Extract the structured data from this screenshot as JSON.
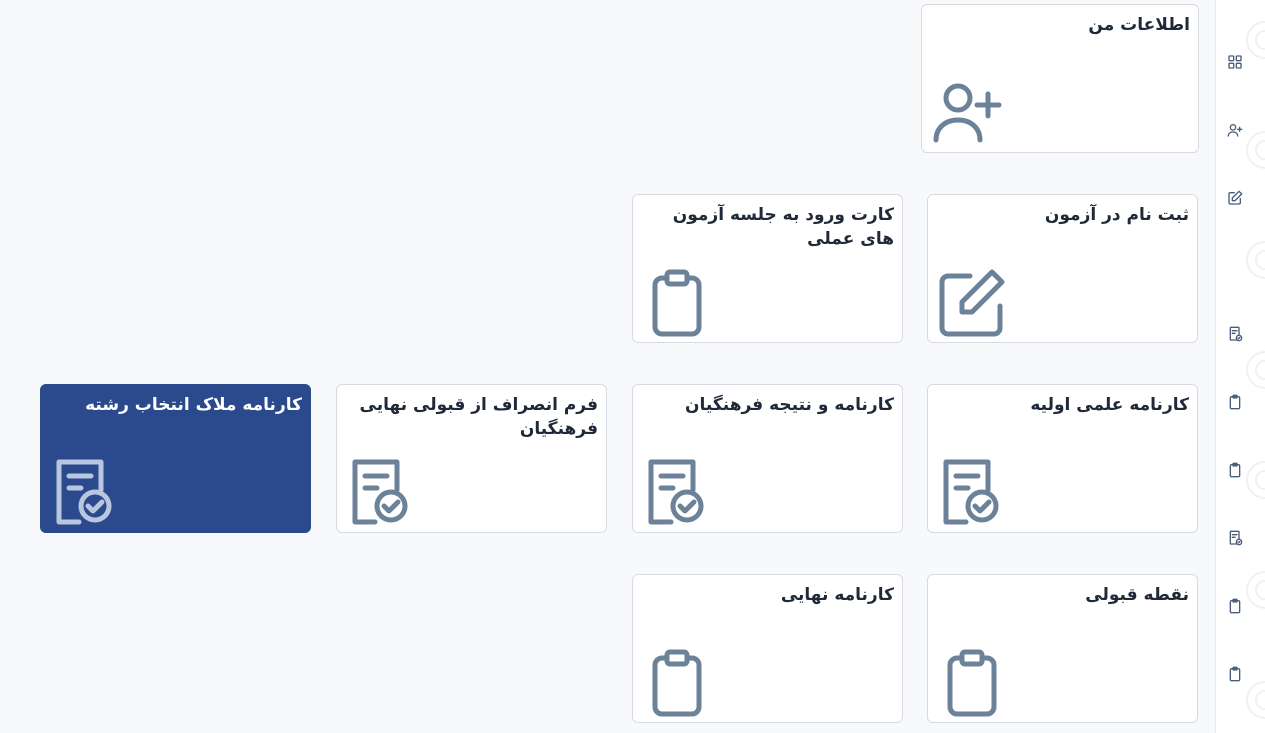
{
  "cards": [
    {
      "title": "اطلاعات من",
      "icon": "user-plus-icon"
    },
    {
      "title": "ثبت نام در آزمون",
      "icon": "edit-icon"
    },
    {
      "title": "کارت ورود به جلسه آزمون های عملی",
      "icon": "clipboard-icon"
    },
    {
      "title": "کارنامه علمی اولیه",
      "icon": "report-check-icon"
    },
    {
      "title": "کارنامه و نتیجه فرهنگیان",
      "icon": "report-check-icon"
    },
    {
      "title": "فرم انصراف از قبولی نهایی فرهنگیان",
      "icon": "report-check-icon"
    },
    {
      "title": "کارنامه ملاک انتخاب رشته",
      "icon": "report-check-icon",
      "active": true
    },
    {
      "title": "نقطه قبولی",
      "icon": "clipboard-icon"
    },
    {
      "title": "کارنامه نهایی",
      "icon": "clipboard-icon"
    }
  ],
  "sidebar": {
    "icons": [
      "grid-icon",
      "user-plus-icon",
      "edit-icon",
      "report-check-icon",
      "clipboard-icon",
      "clipboard-icon",
      "report-check-icon",
      "clipboard-icon",
      "clipboard-icon"
    ]
  },
  "colors": {
    "accent": "#2b4a8e",
    "icon": "#6b8299",
    "background": "#f8f9fb"
  }
}
